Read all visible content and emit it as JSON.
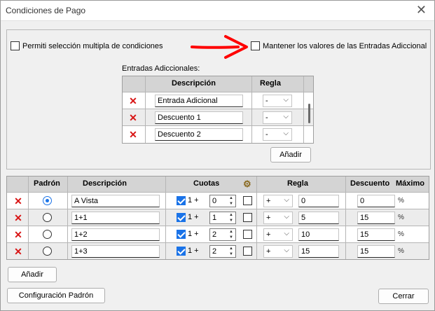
{
  "window": {
    "title": "Condiciones de Pago",
    "close_glyph": "✕"
  },
  "options": {
    "multi_select_label": "Permiti selección multipla de condiciones",
    "keep_values_label": "Mantener los valores de las Entradas Adiccional"
  },
  "additional": {
    "caption": "Entradas Adiccionales:",
    "headers": {
      "description": "Descripción",
      "rule": "Regla"
    },
    "rows": [
      {
        "description": "Entrada Adicional",
        "rule": "-"
      },
      {
        "description": "Descuento 1",
        "rule": "-"
      },
      {
        "description": "Descuento 2",
        "rule": "-"
      }
    ],
    "add_button": "Añadir"
  },
  "conditions": {
    "headers": {
      "default": "Padrón",
      "description": "Descripción",
      "installments": "Cuotas",
      "rule": "Regla",
      "discount": "Descuento",
      "max": "Máximo"
    },
    "rows": [
      {
        "selected": true,
        "description": "A Vista",
        "plus_label": "1 +",
        "installments": "0",
        "rule": "+",
        "rule_value": "0",
        "discount": "0",
        "unit": "%"
      },
      {
        "selected": false,
        "description": "1+1",
        "plus_label": "1 +",
        "installments": "1",
        "rule": "+",
        "rule_value": "5",
        "discount": "15",
        "unit": "%"
      },
      {
        "selected": false,
        "description": "1+2",
        "plus_label": "1 +",
        "installments": "2",
        "rule": "+",
        "rule_value": "10",
        "discount": "15",
        "unit": "%"
      },
      {
        "selected": false,
        "description": "1+3",
        "plus_label": "1 +",
        "installments": "2",
        "rule": "+",
        "rule_value": "15",
        "discount": "15",
        "unit": "%"
      }
    ],
    "add_button": "Añadir"
  },
  "footer": {
    "config_button": "Configuración Padrón",
    "close_button": "Cerrar"
  },
  "colors": {
    "accent": "#1a73e8",
    "delete": "#d81414",
    "arrow": "#ff0000"
  },
  "icons": {
    "delete": "delete-x-icon",
    "settings": "gear-icon",
    "annotation": "red-arrow-annotation"
  }
}
